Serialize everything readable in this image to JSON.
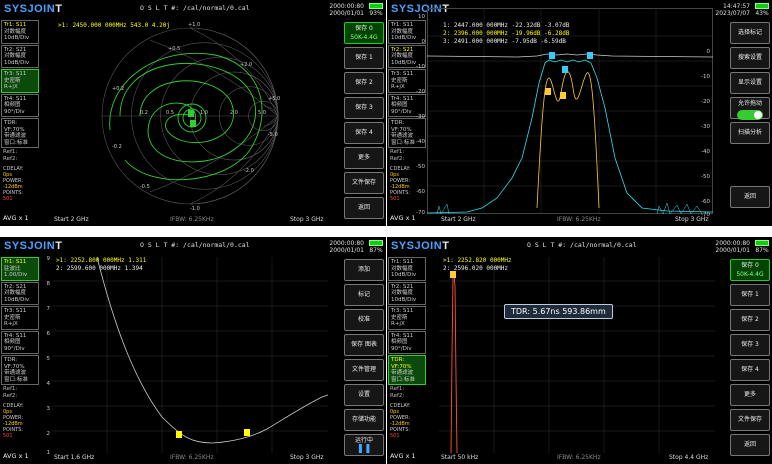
{
  "logo": {
    "a": "SYSJOIN",
    "b": "T"
  },
  "traces_common": {
    "tr2": [
      "Tr2:",
      "S21",
      "对数幅度",
      "10dB/Div"
    ],
    "tr3": [
      "Tr3:",
      "S11",
      "史密斯",
      "R+jX"
    ],
    "tr4": [
      "Tr4:",
      "S11",
      "相频图",
      "90°/Div"
    ],
    "tdr": [
      "TDR:",
      "VF:70%",
      "带通滤波",
      "窗口:标准"
    ],
    "ref1": "Ref1:",
    "ref2": "Ref2:",
    "cdelay": "CDELAY:",
    "cdelay_v": "0ps",
    "power": "POWER:",
    "power_v": "-12dBm",
    "points": "POINTS:",
    "points_v": "501",
    "avg": "AVG x 1",
    "ifbw": "IFBW: 6.25KHz"
  },
  "s1": {
    "title": "O S L T #:   /cal/normal/0.cal",
    "clock": "2000:00:80",
    "date": "2000/01/01",
    "bat": "93%",
    "tr1": [
      "Tr1:",
      "S11",
      "对数幅度",
      "10dB/Div"
    ],
    "marker": ">1:   2450.000 000MHz  543.0  4.20j",
    "menu": [
      "保存 0",
      "50K-4.4G",
      "保存 1",
      "保存 2",
      "保存 3",
      "保存 4",
      "更多",
      "文件保存",
      "返回"
    ],
    "start": "Start  2 GHz",
    "stop": "Stop  3 GHz",
    "labels": [
      "+0.5",
      "+1.0",
      "+2.0",
      "+5.0",
      "+0.2",
      "-0.2",
      "-0.5",
      "-1.0",
      "-2.0",
      "-5.0",
      "0.2",
      "0.5",
      "1.0",
      "2.0",
      "5.0"
    ]
  },
  "s2": {
    "clock": "14:47:57",
    "date": "2023/07/07",
    "bat": "43%",
    "markers": [
      "1:   2447.000 000MHz  -22.32dB   -3.07dB",
      "2:   2396.000 000MHz  -19.96dB   -6.28dB",
      "3:   2491.000 000MHz   -7.95dB   -6.59dB"
    ],
    "yaxis": [
      "10",
      "0",
      "-10",
      "-20",
      "-30",
      "-40",
      "-50",
      "-60",
      "-70"
    ],
    "yaxis_r": [
      "0",
      "-10",
      "-20",
      "-30",
      "-40",
      "-50",
      "-60",
      "-70"
    ],
    "menu": [
      "选择标记",
      "搜索设置",
      "显示设置",
      "允许拖动",
      "扫描分析",
      "返回"
    ],
    "start": "Start  2 GHz",
    "stop": "Stop  3 GHz",
    "tr1": [
      "Tr1:",
      "S11",
      "对数幅度",
      "10dB/Div"
    ],
    "tr2": [
      "Tr2:",
      "S21",
      "对数幅度",
      "10dB/Div"
    ],
    "tr3": [
      "Tr3:",
      "S11",
      "史密斯",
      "R+jX"
    ],
    "tr4": [
      "Tr4:",
      "S11",
      "相频图",
      "90°/Div"
    ]
  },
  "s3": {
    "title": "O S L T #:   /cal/normal/0.cal",
    "clock": "2000:00:80",
    "date": "2000/01/01",
    "bat": "87%",
    "tr1": [
      "Tr1:",
      "S11",
      "驻波比",
      "1.00/Div"
    ],
    "markers": [
      ">1:  2252.800 000MHz     1.311",
      "2:   2599.600 000MHz     1.394"
    ],
    "yaxis": [
      "9",
      "8",
      "7",
      "6",
      "5",
      "4",
      "3",
      "2",
      "1"
    ],
    "menu": [
      "添加",
      "标记",
      "校准",
      "保存 图表",
      "文件管理",
      "设置",
      "存储功能",
      "运行中"
    ],
    "start": "Start  1.6 GHz",
    "stop": "Stop  3 GHz"
  },
  "s4": {
    "title": "O S L T #:   /cal/normal/0.cal",
    "clock": "2000:00:80",
    "date": "2000/01/01",
    "bat": "87%",
    "tr1": [
      "Tr1:",
      "S11",
      "对数幅度",
      "10dB/Div"
    ],
    "markers": [
      ">1:   2252.820 000MHz",
      "2:   2596.020 000MHz"
    ],
    "tdr_box": "TDR: 5.67ns 593.86mm",
    "menu": [
      "保存 0",
      "50K-4.4G",
      "保存 1",
      "保存 2",
      "保存 3",
      "保存 4",
      "更多",
      "文件保存",
      "返回"
    ],
    "start": "Start  50 kHz",
    "stop": "Stop  4.4 GHz"
  },
  "colors": {
    "accent": "#4aa3ff",
    "trace_yellow": "#ffff00",
    "trace_cyan": "#33ddee",
    "trace_green": "#33cc33"
  }
}
